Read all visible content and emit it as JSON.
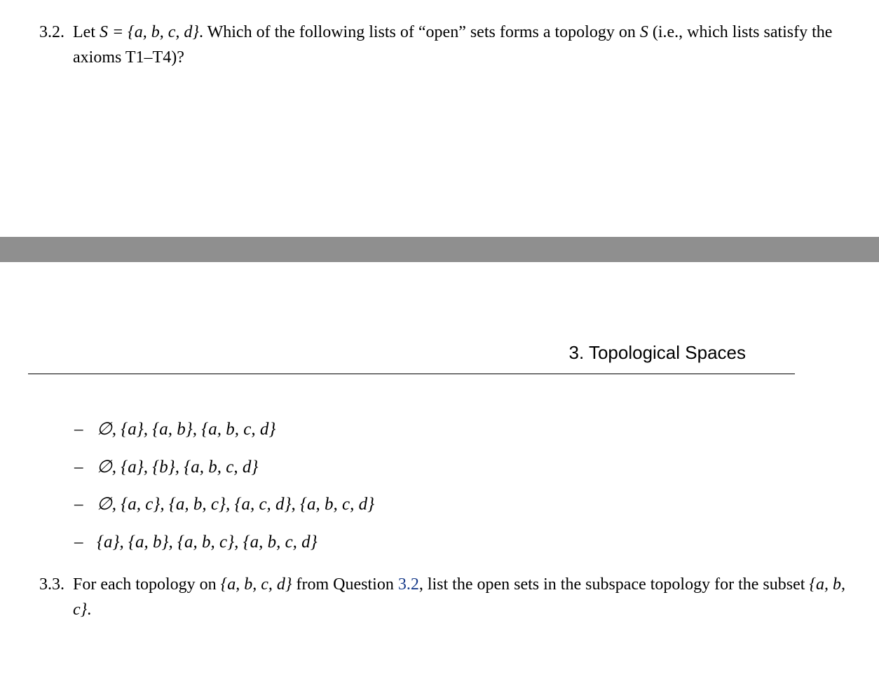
{
  "problem_3_2": {
    "number": "3.2.",
    "text_prefix": "Let ",
    "set_def": "S = {a, b, c, d}",
    "text_mid": ". Which of the following lists of “open” sets forms a topology on ",
    "set_ref": "S",
    "text_suffix": " (i.e., which lists satisfy the axioms T1–T4)?",
    "options": [
      "∅, {a}, {a, b}, {a, b, c, d}",
      "∅, {a}, {b}, {a, b, c, d}",
      "∅, {a, c}, {a, b, c}, {a, c, d}, {a, b, c, d}",
      "{a}, {a, b}, {a, b, c}, {a, b, c, d}"
    ]
  },
  "chapter_heading": "3.  Topological Spaces",
  "problem_3_3": {
    "number": "3.3.",
    "text_1": "For each topology on ",
    "set_full": "{a, b, c, d}",
    "text_2": " from Question ",
    "ref": "3.2",
    "text_3": ", list the open sets in the subspace topology for the subset ",
    "subset": "{a, b, c}",
    "text_4": "."
  },
  "dash": "–"
}
